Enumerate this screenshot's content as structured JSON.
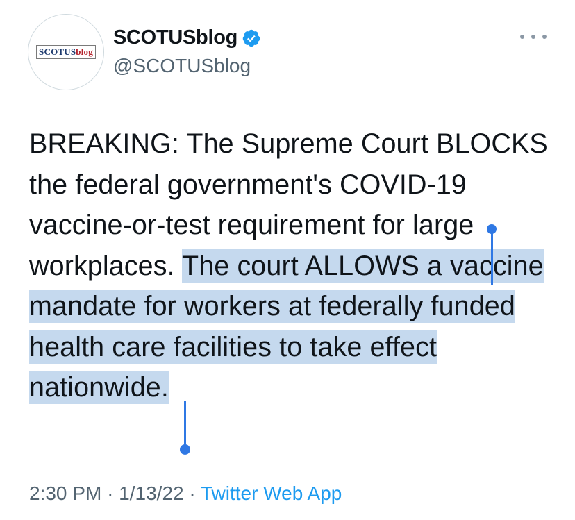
{
  "account": {
    "avatar_logo_part1": "SCOTUS",
    "avatar_logo_part2": "blog",
    "display_name": "SCOTUSblog",
    "handle": "@SCOTUSblog",
    "verified": true
  },
  "tweet": {
    "text_unselected": "BREAKING: The Supreme Court BLOCKS the federal government's COVID-19 vaccine-or-test requirement for large workplaces. ",
    "text_selected": "The court ALLOWS a vaccine mandate for workers at federally funded health care facilities to take effect nationwide.",
    "time": "2:30 PM",
    "separator": "·",
    "date": "1/13/22",
    "source": "Twitter Web App"
  },
  "colors": {
    "selection": "#c5d9ee",
    "selection_handle": "#2f78e4",
    "link": "#1d9bf0",
    "verified_badge": "#1d9bf0",
    "secondary_text": "#536471"
  },
  "icons": {
    "verified": "verified-badge-icon",
    "more": "more-options-icon"
  }
}
